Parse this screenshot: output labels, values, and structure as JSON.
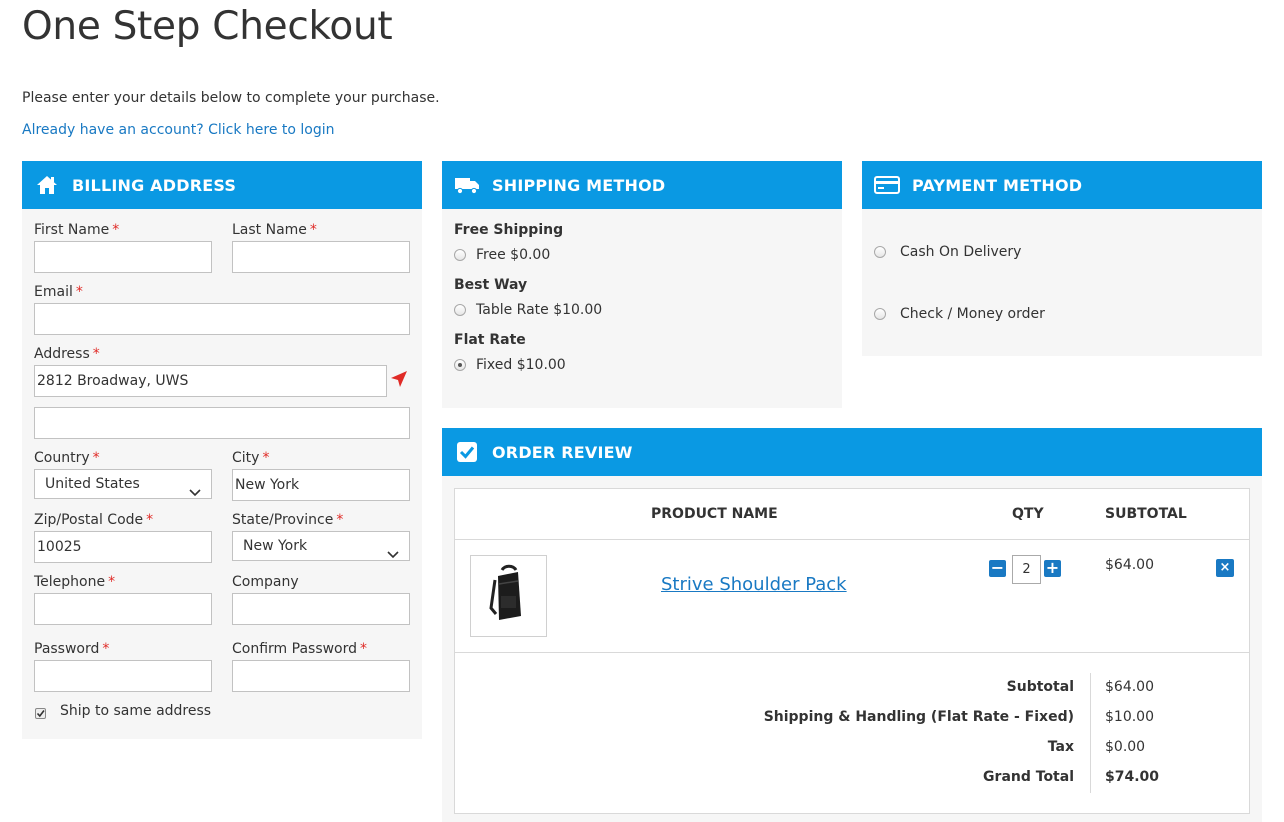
{
  "page": {
    "title": "One Step Checkout",
    "intro": "Please enter your details below to complete your purchase.",
    "login_link": "Already have an account? Click here to login"
  },
  "billing": {
    "header": "BILLING ADDRESS",
    "icon": "home-icon",
    "first_name": {
      "label": "First Name",
      "value": ""
    },
    "last_name": {
      "label": "Last Name",
      "value": ""
    },
    "email": {
      "label": "Email",
      "value": ""
    },
    "address": {
      "label": "Address",
      "value": "2812 Broadway, UWS",
      "line2": ""
    },
    "country": {
      "label": "Country",
      "value": "United States"
    },
    "city": {
      "label": "City",
      "value": "New York"
    },
    "zip": {
      "label": "Zip/Postal Code",
      "value": "10025"
    },
    "state": {
      "label": "State/Province",
      "value": "New York"
    },
    "telephone": {
      "label": "Telephone",
      "value": ""
    },
    "company": {
      "label": "Company",
      "value": ""
    },
    "password": {
      "label": "Password",
      "value": ""
    },
    "confirm_password": {
      "label": "Confirm Password",
      "value": ""
    },
    "ship_same": {
      "label": "Ship to same address",
      "checked": true
    },
    "required_mark": "*"
  },
  "shipping": {
    "header": "SHIPPING METHOD",
    "icon": "truck-icon",
    "groups": [
      {
        "title": "Free Shipping",
        "option": "Free $0.00",
        "selected": false
      },
      {
        "title": "Best Way",
        "option": "Table Rate $10.00",
        "selected": false
      },
      {
        "title": "Flat Rate",
        "option": "Fixed $10.00",
        "selected": true
      }
    ]
  },
  "payment": {
    "header": "PAYMENT METHOD",
    "icon": "credit-card-icon",
    "options": [
      {
        "label": "Cash On Delivery",
        "selected": false
      },
      {
        "label": "Check / Money order",
        "selected": false
      }
    ]
  },
  "review": {
    "header": "ORDER REVIEW",
    "icon": "checkbox-icon",
    "columns": {
      "product": "PRODUCT NAME",
      "qty": "QTY",
      "subtotal": "SUBTOTAL"
    },
    "item": {
      "name": "Strive Shoulder Pack",
      "qty": "2",
      "price": "$64.00",
      "remove": "×",
      "minus": "−",
      "plus": "+"
    },
    "totals": [
      {
        "label": "Subtotal",
        "value": "$64.00"
      },
      {
        "label": "Shipping & Handling (Flat Rate - Fixed)",
        "value": "$10.00"
      },
      {
        "label": "Tax",
        "value": "$0.00"
      },
      {
        "label": "Grand Total",
        "value": "$74.00"
      }
    ]
  },
  "colors": {
    "accent": "#0a99e3",
    "link": "#1979c3",
    "required": "#e02b27",
    "panel_bg": "#f6f6f6"
  }
}
